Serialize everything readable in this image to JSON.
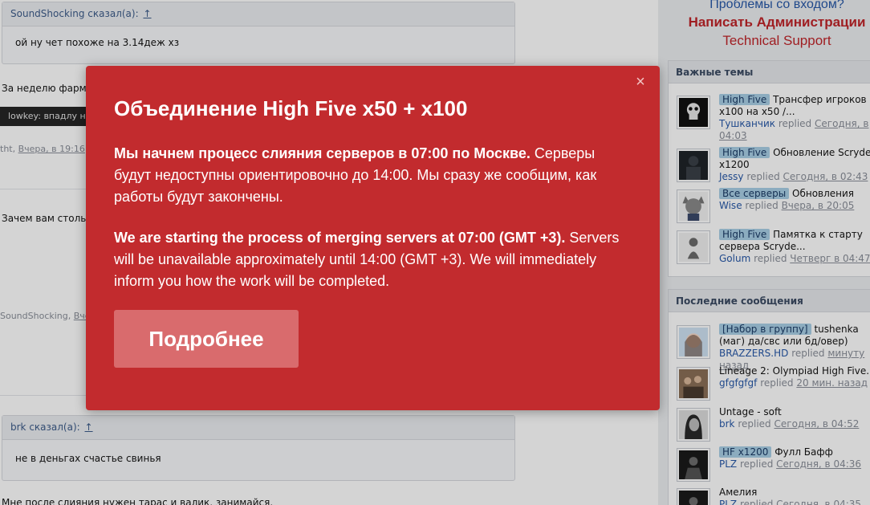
{
  "forum": {
    "quote1": {
      "author": "SoundShocking сказал(а):",
      "up": "↑",
      "text": "ой ну чет похоже на 3.14деж хз"
    },
    "post1_text": "За неделю фарма",
    "signature": "lowkey: впадлу н",
    "meta1": {
      "author": "tht,",
      "date": "Вчера, в 19:16"
    },
    "post2_text": "Зачем вам стольк",
    "meta2": {
      "author": "SoundShocking,",
      "date": "Вче"
    },
    "quote2": {
      "author": "brk сказал(а):",
      "up": "↑",
      "text": "не в деньгах счастье свинья"
    },
    "post3_text": "Мне после слияния нужен тарас и валик, занимайся."
  },
  "login": {
    "question": "Проблемы со входом?",
    "admin_link": "Написать Администрации",
    "support_link": "Technical Support"
  },
  "important": {
    "title": "Важные темы",
    "items": [
      {
        "tag": "High Five",
        "title": "Трансфер игроков с x100 на x50 /...",
        "user": "Тушканчик",
        "action": "replied",
        "time": "Сегодня, в 04:03",
        "avatar_icon": "skull-avatar-icon"
      },
      {
        "tag": "High Five",
        "title": "Обновление Scryde x1200",
        "user": "Jessy",
        "action": "replied",
        "time": "Сегодня, в 02:43",
        "avatar_icon": "dark-figure-avatar-icon"
      },
      {
        "tag": "Все серверы",
        "title": "Обновления",
        "user": "Wise",
        "action": "replied",
        "time": "Вчера, в 20:05",
        "avatar_icon": "cat-avatar-icon"
      },
      {
        "tag": "High Five",
        "title": "Памятка к старту сервера Scryde...",
        "user": "Golum",
        "action": "replied",
        "time": "Четверг в 04:47",
        "avatar_icon": "gollum-avatar-icon"
      }
    ]
  },
  "recent": {
    "title": "Последние сообщения",
    "items": [
      {
        "tag": "[Набор в группу]",
        "title": "tushenka (маг) да/свс или бд/овер)",
        "user": "BRAZZERS.HD",
        "action": "replied",
        "time": "минуту назад",
        "avatar_icon": "anime-girl-avatar-icon"
      },
      {
        "tag": "",
        "title": "Lineage 2: Olympiad High Five...",
        "user": "gfgfgfgf",
        "action": "replied",
        "time": "20 мин. назад",
        "avatar_icon": "group-photo-avatar-icon"
      },
      {
        "tag": "",
        "title": "Untage - soft",
        "user": "brk",
        "action": "replied",
        "time": "Сегодня, в 04:52",
        "avatar_icon": "woman-portrait-avatar-icon"
      },
      {
        "tag": "HF x1200",
        "title": "Фулл Бафф",
        "user": "PLZ",
        "action": "replied",
        "time": "Сегодня, в 04:36",
        "avatar_icon": "warrior-avatar-icon"
      },
      {
        "tag": "",
        "title": "Амелия",
        "user": "PLZ",
        "action": "replied",
        "time": "Сегодня, в 04:35",
        "avatar_icon": "warrior-avatar-icon"
      }
    ]
  },
  "modal": {
    "title": "Объединение High Five x50 + x100",
    "ru_bold": "Мы начнем процесс слияния серверов в 07:00 по Москве.",
    "ru_rest": "Серверы будут недоступны ориентировочно до 14:00. Мы сразу же сообщим, как работы будут закончены.",
    "en_bold": "We are starting the process of merging servers at 07:00 (GMT +3).",
    "en_rest": "Servers will be unavailable approximately until 14:00 (GMT +3). We will immediately inform you how the work will be completed.",
    "button": "Подробнее",
    "close_icon": "×",
    "bg_color": "#c22b2e",
    "button_color": "#d96b6d"
  }
}
